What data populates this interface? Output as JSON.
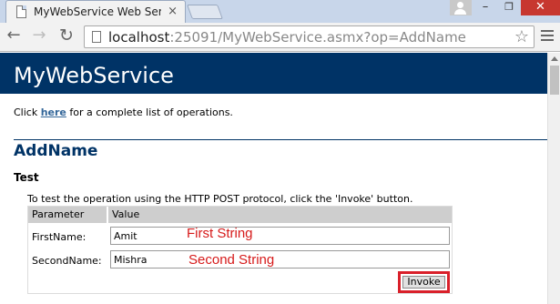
{
  "browser": {
    "tab_title": "MyWebService Web Servi",
    "tab_close": "×",
    "url_host": "localhost",
    "url_rest": ":25091/MyWebService.asmx?op=AddName",
    "window": {
      "minimize": "–",
      "maximize": "❐",
      "close": "✕"
    },
    "nav": {
      "back": "←",
      "forward": "→",
      "reload": "↻",
      "star": "☆"
    }
  },
  "page": {
    "banner_title": "MyWebService",
    "intro_before": "Click ",
    "intro_link": "here",
    "intro_after": " for a complete list of operations.",
    "operation_name": "AddName",
    "test_heading": "Test",
    "test_description": "To test the operation using the HTTP POST protocol, click the 'Invoke' button.",
    "table": {
      "header_parameter": "Parameter",
      "header_value": "Value",
      "fields": [
        {
          "label": "FirstName:",
          "value": "Amit"
        },
        {
          "label": "SecondName:",
          "value": "Mishra"
        }
      ]
    },
    "invoke_label": "Invoke"
  },
  "annotations": {
    "first": "First String",
    "second": "Second String",
    "color": "#d61a1a"
  },
  "colors": {
    "banner": "#003366",
    "link": "#336699",
    "highlight_border": "#d9202a"
  }
}
